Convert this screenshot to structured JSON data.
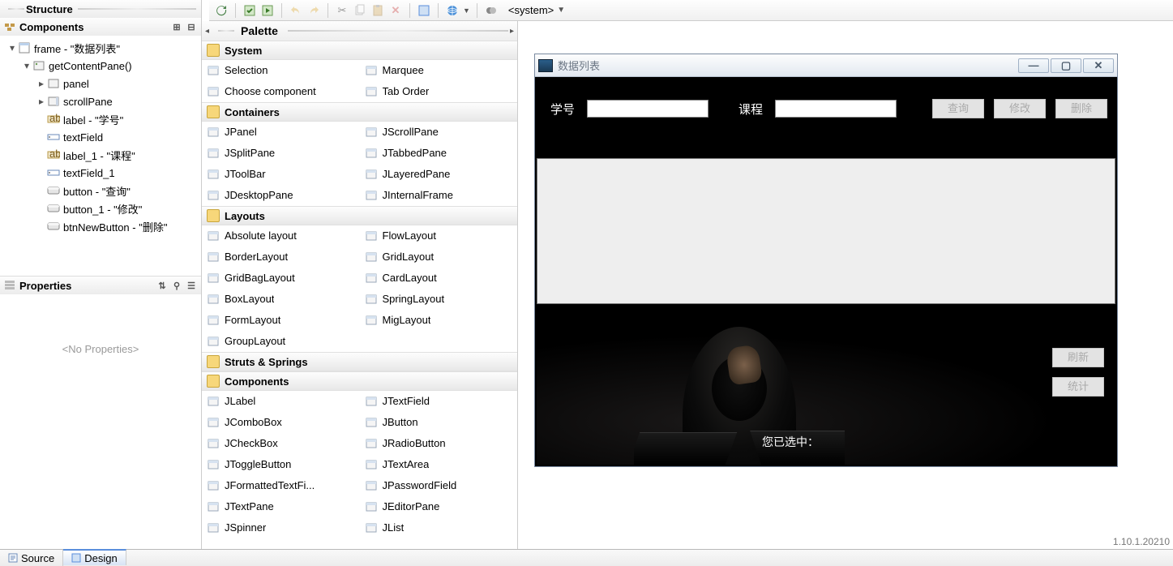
{
  "structure": {
    "title": "Structure"
  },
  "components_pane": {
    "title": "Components",
    "tree": [
      {
        "indent": 0,
        "twist": "▾",
        "icon": "frame",
        "label": "frame - \"数据列表\""
      },
      {
        "indent": 1,
        "twist": "▾",
        "icon": "method",
        "label": "getContentPane()"
      },
      {
        "indent": 2,
        "twist": "▸",
        "icon": "panel",
        "label": "panel"
      },
      {
        "indent": 2,
        "twist": "▸",
        "icon": "scrollpane",
        "label": "scrollPane"
      },
      {
        "indent": 2,
        "twist": "",
        "icon": "label",
        "label": "label - \"学号\""
      },
      {
        "indent": 2,
        "twist": "",
        "icon": "textfield",
        "label": "textField"
      },
      {
        "indent": 2,
        "twist": "",
        "icon": "label",
        "label": "label_1 - \"课程\""
      },
      {
        "indent": 2,
        "twist": "",
        "icon": "textfield",
        "label": "textField_1"
      },
      {
        "indent": 2,
        "twist": "",
        "icon": "button",
        "label": "button - \"查询\""
      },
      {
        "indent": 2,
        "twist": "",
        "icon": "button",
        "label": "button_1 - \"修改\""
      },
      {
        "indent": 2,
        "twist": "",
        "icon": "button",
        "label": "btnNewButton - \"删除\""
      }
    ]
  },
  "properties": {
    "title": "Properties",
    "empty": "<No Properties>"
  },
  "palette": {
    "title": "Palette",
    "groups": [
      {
        "name": "System",
        "items": [
          "Selection",
          "Marquee",
          "Choose component",
          "Tab Order"
        ]
      },
      {
        "name": "Containers",
        "items": [
          "JPanel",
          "JScrollPane",
          "JSplitPane",
          "JTabbedPane",
          "JToolBar",
          "JLayeredPane",
          "JDesktopPane",
          "JInternalFrame"
        ]
      },
      {
        "name": "Layouts",
        "items": [
          "Absolute layout",
          "FlowLayout",
          "BorderLayout",
          "GridLayout",
          "GridBagLayout",
          "CardLayout",
          "BoxLayout",
          "SpringLayout",
          "FormLayout",
          "MigLayout",
          "GroupLayout"
        ]
      },
      {
        "name": "Struts & Springs",
        "items": []
      },
      {
        "name": "Components",
        "items": [
          "JLabel",
          "JTextField",
          "JComboBox",
          "JButton",
          "JCheckBox",
          "JRadioButton",
          "JToggleButton",
          "JTextArea",
          "JFormattedTextFi...",
          "JPasswordField",
          "JTextPane",
          "JEditorPane",
          "JSpinner",
          "JList"
        ]
      }
    ]
  },
  "toolbar": {
    "system_label": "<system>"
  },
  "designer": {
    "window_title": "数据列表",
    "labels": {
      "id": "学号",
      "course": "课程"
    },
    "buttons": {
      "query": "查询",
      "edit": "修改",
      "delete": "删除",
      "refresh": "刷新",
      "stats": "统计"
    },
    "status": "您已选中："
  },
  "bottom_tabs": {
    "source": "Source",
    "design": "Design"
  },
  "version": "1.10.1.20210"
}
